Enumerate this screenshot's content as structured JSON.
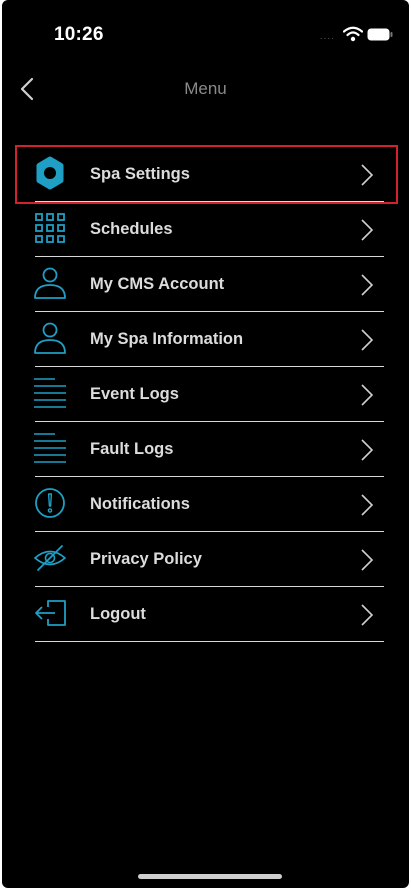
{
  "status_bar": {
    "time": "10:26",
    "signal": "....",
    "icons": [
      "wifi-icon",
      "battery-icon"
    ]
  },
  "nav": {
    "title": "Menu",
    "back_icon": "back-chevron-icon"
  },
  "menu": {
    "items": [
      {
        "label": "Spa Settings",
        "icon": "gear-icon",
        "highlighted": true
      },
      {
        "label": "Schedules",
        "icon": "grid-icon"
      },
      {
        "label": "My CMS Account",
        "icon": "user-icon"
      },
      {
        "label": "My Spa Information",
        "icon": "user-icon"
      },
      {
        "label": "Event Logs",
        "icon": "list-lines-icon"
      },
      {
        "label": "Fault Logs",
        "icon": "list-lines-icon"
      },
      {
        "label": "Notifications",
        "icon": "exclamation-circle-icon"
      },
      {
        "label": "Privacy Policy",
        "icon": "eye-slash-icon"
      },
      {
        "label": "Logout",
        "icon": "logout-icon"
      }
    ]
  },
  "colors": {
    "background": "#000000",
    "accent": "#1f9fc4",
    "text": "#dcdcdc",
    "divider": "#d8d8d8",
    "highlight_box": "#d2222d"
  }
}
